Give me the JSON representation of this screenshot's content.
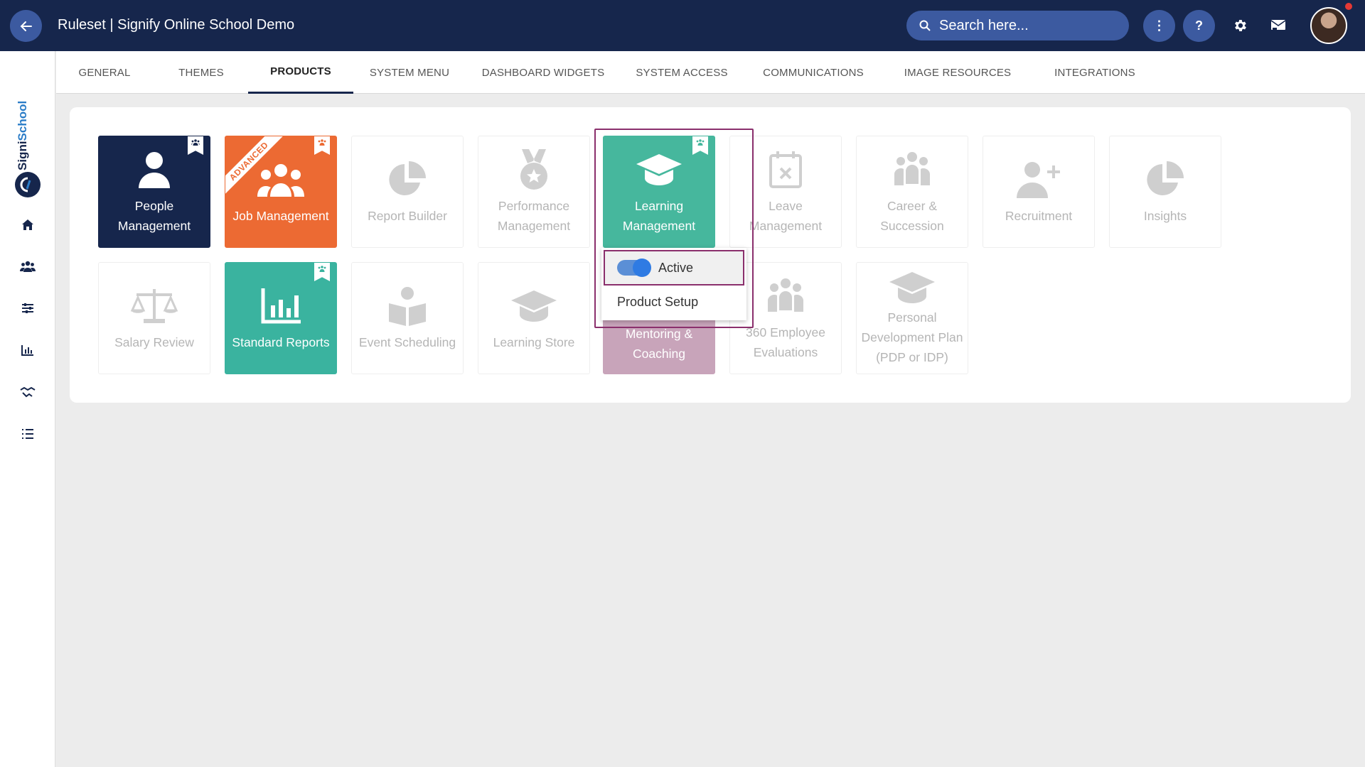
{
  "header": {
    "title": "Ruleset | Signify Online School Demo",
    "search_placeholder": "Search here...",
    "more_label": "⋮",
    "help_label": "?"
  },
  "sidebar": {
    "logo_brand": "Signi",
    "logo_brand_2": "School",
    "items": [
      "home-icon",
      "people-icon",
      "sliders-icon",
      "bar-chart-icon",
      "handshake-icon",
      "list-icon"
    ]
  },
  "tabs": [
    {
      "label": "GENERAL"
    },
    {
      "label": "THEMES"
    },
    {
      "label": "PRODUCTS",
      "active": true
    },
    {
      "label": "SYSTEM MENU"
    },
    {
      "label": "DASHBOARD WIDGETS"
    },
    {
      "label": "SYSTEM ACCESS"
    },
    {
      "label": "COMMUNICATIONS"
    },
    {
      "label": "IMAGE RESOURCES"
    },
    {
      "label": "INTEGRATIONS"
    }
  ],
  "products": {
    "people_management": "People Management",
    "job_management": "Job Management",
    "job_management_ribbon": "ADVANCED",
    "report_builder": "Report Builder",
    "performance_management": "Performance Management",
    "learning_management": "Learning Management",
    "leave_management": "Leave Management",
    "career_succession": "Career & Succession",
    "recruitment": "Recruitment",
    "insights": "Insights",
    "salary_review": "Salary Review",
    "standard_reports": "Standard Reports",
    "event_scheduling": "Event Scheduling",
    "learning_store": "Learning Store",
    "mentoring_coaching": "Mentoring & Coaching",
    "employee_evaluations": "360 Employee Evaluations",
    "personal_development_plan": "Personal Development Plan (PDP or IDP)"
  },
  "dropdown": {
    "active_label": "Active",
    "active_state": true,
    "setup_label": "Product Setup"
  },
  "colors": {
    "topbar": "#16264c",
    "accent": "#3c5aa0",
    "orange": "#ec6a33",
    "teal": "#46b79d",
    "mauve": "#c8a4ba",
    "highlight": "#8a2f6c"
  }
}
